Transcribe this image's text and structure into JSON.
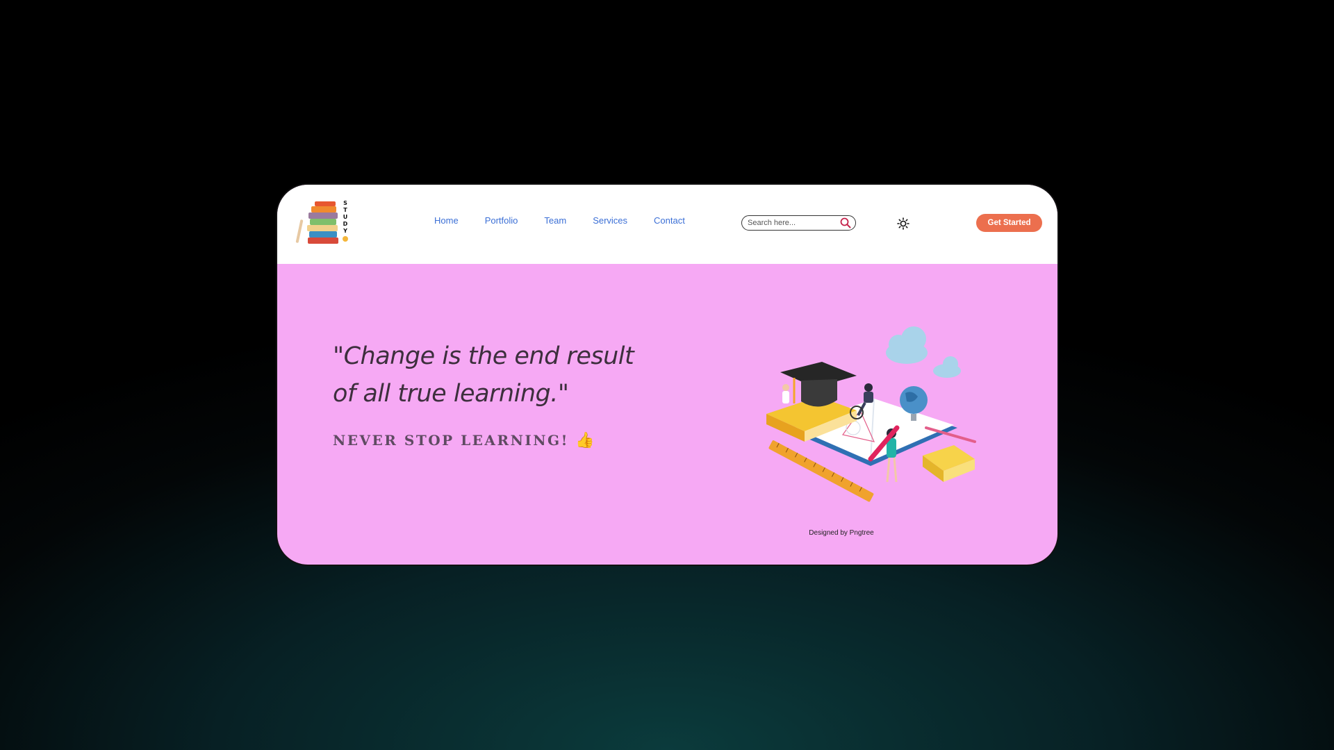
{
  "nav": {
    "links": [
      "Home",
      "Portfolio",
      "Team",
      "Services",
      "Contact"
    ]
  },
  "brand": {
    "logo_text": "STUDY"
  },
  "search": {
    "placeholder": "Search here..."
  },
  "header": {
    "cta_label": "Get Started"
  },
  "hero": {
    "quote_line1": "\"Change is the end result",
    "quote_line2": "of all true learning.\"",
    "tagline": "NEVER STOP LEARNING!",
    "tagline_emoji": "👍",
    "credit": "Designed by Pngtree"
  },
  "icons": {
    "search": "search-icon",
    "theme": "sun-icon"
  },
  "colors": {
    "hero_bg": "#f6a9f4",
    "cta_bg": "#ec6f4e",
    "nav_link": "#3b6fd6"
  }
}
